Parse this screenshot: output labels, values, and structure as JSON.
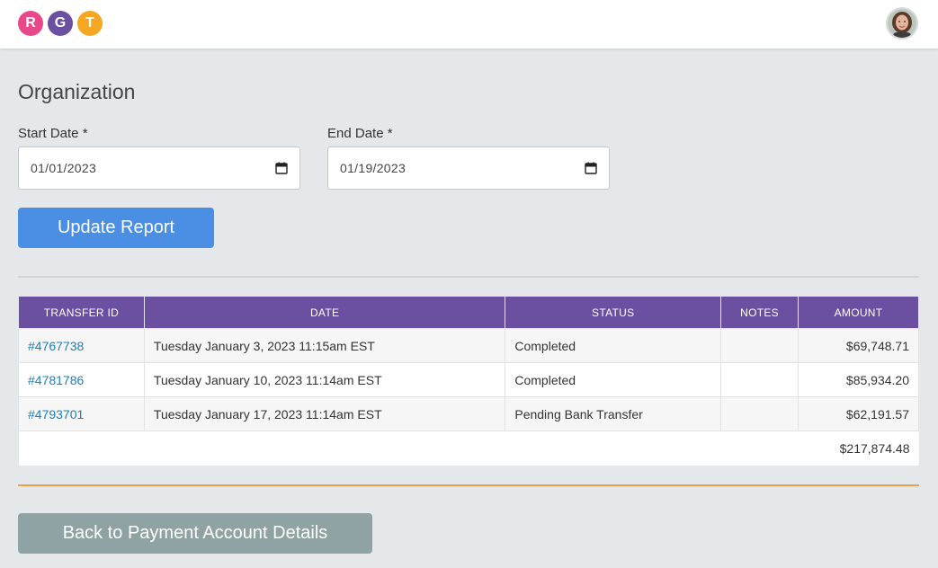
{
  "brand": {
    "letters": [
      "R",
      "G",
      "T"
    ],
    "colors": [
      "#e8488a",
      "#6b4fa0",
      "#f5a623"
    ]
  },
  "header": {
    "avatar_icon": "user-avatar"
  },
  "page": {
    "title": "Organization"
  },
  "form": {
    "start_label": "Start Date *",
    "start_value": "01/01/2023",
    "end_label": "End Date *",
    "end_value": "01/19/2023",
    "calendar_icon": "calendar-icon",
    "update_button": "Update Report"
  },
  "table": {
    "headers": [
      "TRANSFER ID",
      "DATE",
      "STATUS",
      "NOTES",
      "AMOUNT"
    ],
    "rows": [
      {
        "id": "#4767738",
        "date": "Tuesday January 3, 2023 11:15am EST",
        "status": "Completed",
        "notes": "",
        "amount": "$69,748.71"
      },
      {
        "id": "#4781786",
        "date": "Tuesday January 10, 2023 11:14am EST",
        "status": "Completed",
        "notes": "",
        "amount": "$85,934.20"
      },
      {
        "id": "#4793701",
        "date": "Tuesday January 17, 2023 11:14am EST",
        "status": "Pending Bank Transfer",
        "notes": "",
        "amount": "$62,191.57"
      }
    ],
    "total": "$217,874.48"
  },
  "footer": {
    "back_button": "Back to Payment Account Details"
  },
  "colors": {
    "accent": "#6b4fa0",
    "primary_button": "#4a8fe3",
    "secondary_button": "#8fa3a5",
    "link": "#1d7fb8",
    "divider_orange": "#f0a04a"
  }
}
